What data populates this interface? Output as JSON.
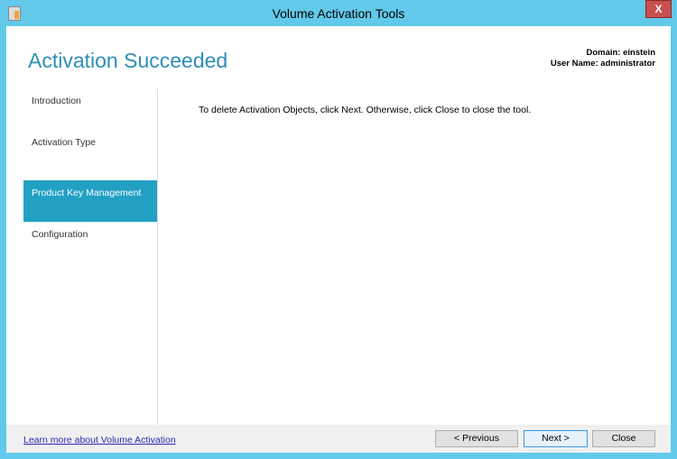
{
  "window": {
    "title": "Volume Activation Tools",
    "close_label": "X"
  },
  "header": {
    "title": "Activation Succeeded",
    "domain": "Domain: einstein",
    "user": "User Name: administrator"
  },
  "sidebar": {
    "items": [
      {
        "label": "Introduction",
        "selected": false
      },
      {
        "label": "Activation Type",
        "selected": false
      },
      {
        "label": "Product Key Management",
        "selected": true
      },
      {
        "label": "Configuration",
        "selected": false
      }
    ]
  },
  "main": {
    "message": "To delete Activation Objects, click Next. Otherwise, click Close to close the tool."
  },
  "footer": {
    "link": "Learn more about Volume Activation",
    "previous": "< Previous",
    "next": "Next >",
    "close": "Close"
  }
}
